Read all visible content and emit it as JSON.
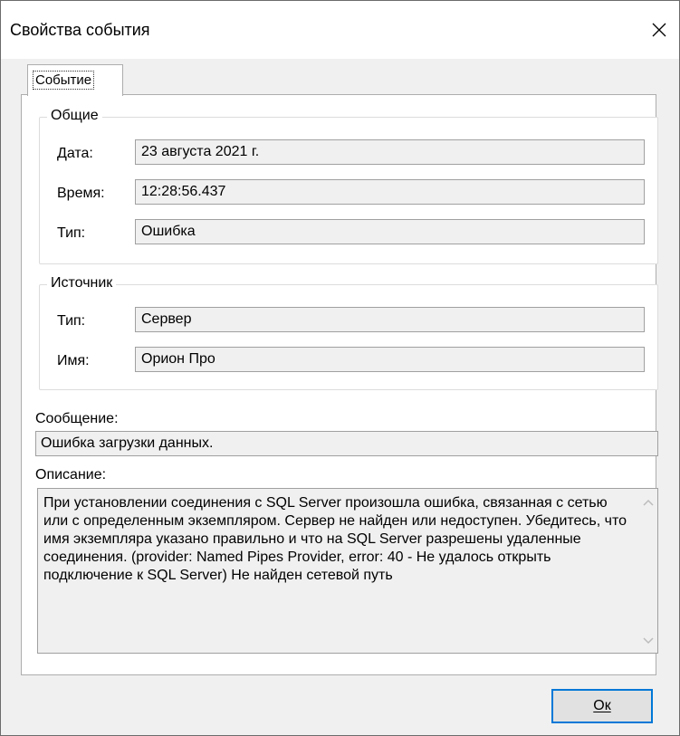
{
  "window": {
    "title": "Свойства события"
  },
  "tabs": [
    {
      "label": "Событие"
    }
  ],
  "general": {
    "legend": "Общие",
    "date_label": "Дата:",
    "date_value": "23 августа 2021 г.",
    "time_label": "Время:",
    "time_value": "12:28:56.437",
    "type_label": "Тип:",
    "type_value": "Ошибка"
  },
  "source": {
    "legend": "Источник",
    "type_label": "Тип:",
    "type_value": "Сервер",
    "name_label": "Имя:",
    "name_value": "Орион Про"
  },
  "message": {
    "label": "Сообщение:",
    "value": "Ошибка загрузки данных."
  },
  "description": {
    "label": "Описание:",
    "value": "При установлении соединения с SQL Server произошла ошибка, связанная с сетью или с определенным экземпляром. Сервер не найден или недоступен. Убедитесь, что имя экземпляра указано правильно и что на SQL Server разрешены удаленные соединения. (provider: Named Pipes Provider, error: 40 - Не удалось открыть подключение к SQL Server) Не найден сетевой путь"
  },
  "ok_button": {
    "label": "Ок",
    "accent_color": "#0078d7"
  },
  "icons": {
    "close": "close-icon",
    "scroll_up": "chevron-up-icon",
    "scroll_down": "chevron-down-icon"
  }
}
